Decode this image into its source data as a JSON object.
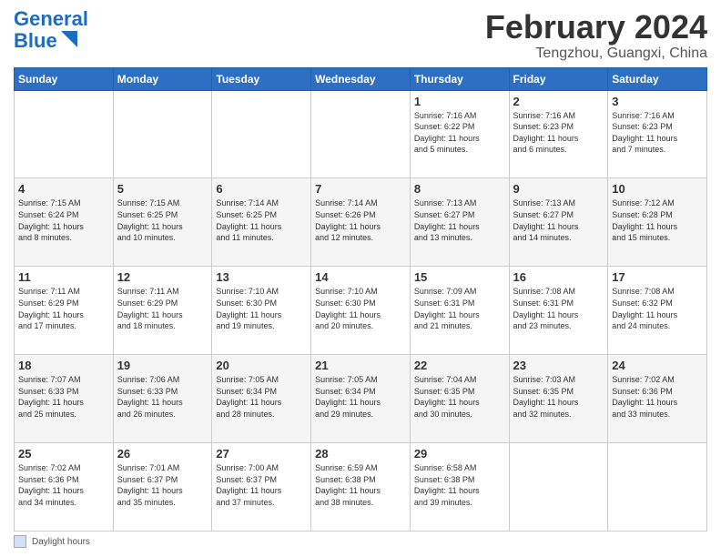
{
  "header": {
    "logo_line1": "General",
    "logo_line2": "Blue",
    "title": "February 2024",
    "location": "Tengzhou, Guangxi, China"
  },
  "calendar": {
    "days_of_week": [
      "Sunday",
      "Monday",
      "Tuesday",
      "Wednesday",
      "Thursday",
      "Friday",
      "Saturday"
    ],
    "weeks": [
      [
        {
          "day": "",
          "info": ""
        },
        {
          "day": "",
          "info": ""
        },
        {
          "day": "",
          "info": ""
        },
        {
          "day": "",
          "info": ""
        },
        {
          "day": "1",
          "info": "Sunrise: 7:16 AM\nSunset: 6:22 PM\nDaylight: 11 hours\nand 5 minutes."
        },
        {
          "day": "2",
          "info": "Sunrise: 7:16 AM\nSunset: 6:23 PM\nDaylight: 11 hours\nand 6 minutes."
        },
        {
          "day": "3",
          "info": "Sunrise: 7:16 AM\nSunset: 6:23 PM\nDaylight: 11 hours\nand 7 minutes."
        }
      ],
      [
        {
          "day": "4",
          "info": "Sunrise: 7:15 AM\nSunset: 6:24 PM\nDaylight: 11 hours\nand 8 minutes."
        },
        {
          "day": "5",
          "info": "Sunrise: 7:15 AM\nSunset: 6:25 PM\nDaylight: 11 hours\nand 10 minutes."
        },
        {
          "day": "6",
          "info": "Sunrise: 7:14 AM\nSunset: 6:25 PM\nDaylight: 11 hours\nand 11 minutes."
        },
        {
          "day": "7",
          "info": "Sunrise: 7:14 AM\nSunset: 6:26 PM\nDaylight: 11 hours\nand 12 minutes."
        },
        {
          "day": "8",
          "info": "Sunrise: 7:13 AM\nSunset: 6:27 PM\nDaylight: 11 hours\nand 13 minutes."
        },
        {
          "day": "9",
          "info": "Sunrise: 7:13 AM\nSunset: 6:27 PM\nDaylight: 11 hours\nand 14 minutes."
        },
        {
          "day": "10",
          "info": "Sunrise: 7:12 AM\nSunset: 6:28 PM\nDaylight: 11 hours\nand 15 minutes."
        }
      ],
      [
        {
          "day": "11",
          "info": "Sunrise: 7:11 AM\nSunset: 6:29 PM\nDaylight: 11 hours\nand 17 minutes."
        },
        {
          "day": "12",
          "info": "Sunrise: 7:11 AM\nSunset: 6:29 PM\nDaylight: 11 hours\nand 18 minutes."
        },
        {
          "day": "13",
          "info": "Sunrise: 7:10 AM\nSunset: 6:30 PM\nDaylight: 11 hours\nand 19 minutes."
        },
        {
          "day": "14",
          "info": "Sunrise: 7:10 AM\nSunset: 6:30 PM\nDaylight: 11 hours\nand 20 minutes."
        },
        {
          "day": "15",
          "info": "Sunrise: 7:09 AM\nSunset: 6:31 PM\nDaylight: 11 hours\nand 21 minutes."
        },
        {
          "day": "16",
          "info": "Sunrise: 7:08 AM\nSunset: 6:31 PM\nDaylight: 11 hours\nand 23 minutes."
        },
        {
          "day": "17",
          "info": "Sunrise: 7:08 AM\nSunset: 6:32 PM\nDaylight: 11 hours\nand 24 minutes."
        }
      ],
      [
        {
          "day": "18",
          "info": "Sunrise: 7:07 AM\nSunset: 6:33 PM\nDaylight: 11 hours\nand 25 minutes."
        },
        {
          "day": "19",
          "info": "Sunrise: 7:06 AM\nSunset: 6:33 PM\nDaylight: 11 hours\nand 26 minutes."
        },
        {
          "day": "20",
          "info": "Sunrise: 7:05 AM\nSunset: 6:34 PM\nDaylight: 11 hours\nand 28 minutes."
        },
        {
          "day": "21",
          "info": "Sunrise: 7:05 AM\nSunset: 6:34 PM\nDaylight: 11 hours\nand 29 minutes."
        },
        {
          "day": "22",
          "info": "Sunrise: 7:04 AM\nSunset: 6:35 PM\nDaylight: 11 hours\nand 30 minutes."
        },
        {
          "day": "23",
          "info": "Sunrise: 7:03 AM\nSunset: 6:35 PM\nDaylight: 11 hours\nand 32 minutes."
        },
        {
          "day": "24",
          "info": "Sunrise: 7:02 AM\nSunset: 6:36 PM\nDaylight: 11 hours\nand 33 minutes."
        }
      ],
      [
        {
          "day": "25",
          "info": "Sunrise: 7:02 AM\nSunset: 6:36 PM\nDaylight: 11 hours\nand 34 minutes."
        },
        {
          "day": "26",
          "info": "Sunrise: 7:01 AM\nSunset: 6:37 PM\nDaylight: 11 hours\nand 35 minutes."
        },
        {
          "day": "27",
          "info": "Sunrise: 7:00 AM\nSunset: 6:37 PM\nDaylight: 11 hours\nand 37 minutes."
        },
        {
          "day": "28",
          "info": "Sunrise: 6:59 AM\nSunset: 6:38 PM\nDaylight: 11 hours\nand 38 minutes."
        },
        {
          "day": "29",
          "info": "Sunrise: 6:58 AM\nSunset: 6:38 PM\nDaylight: 11 hours\nand 39 minutes."
        },
        {
          "day": "",
          "info": ""
        },
        {
          "day": "",
          "info": ""
        }
      ]
    ]
  },
  "footer": {
    "legend_label": "Daylight hours"
  }
}
